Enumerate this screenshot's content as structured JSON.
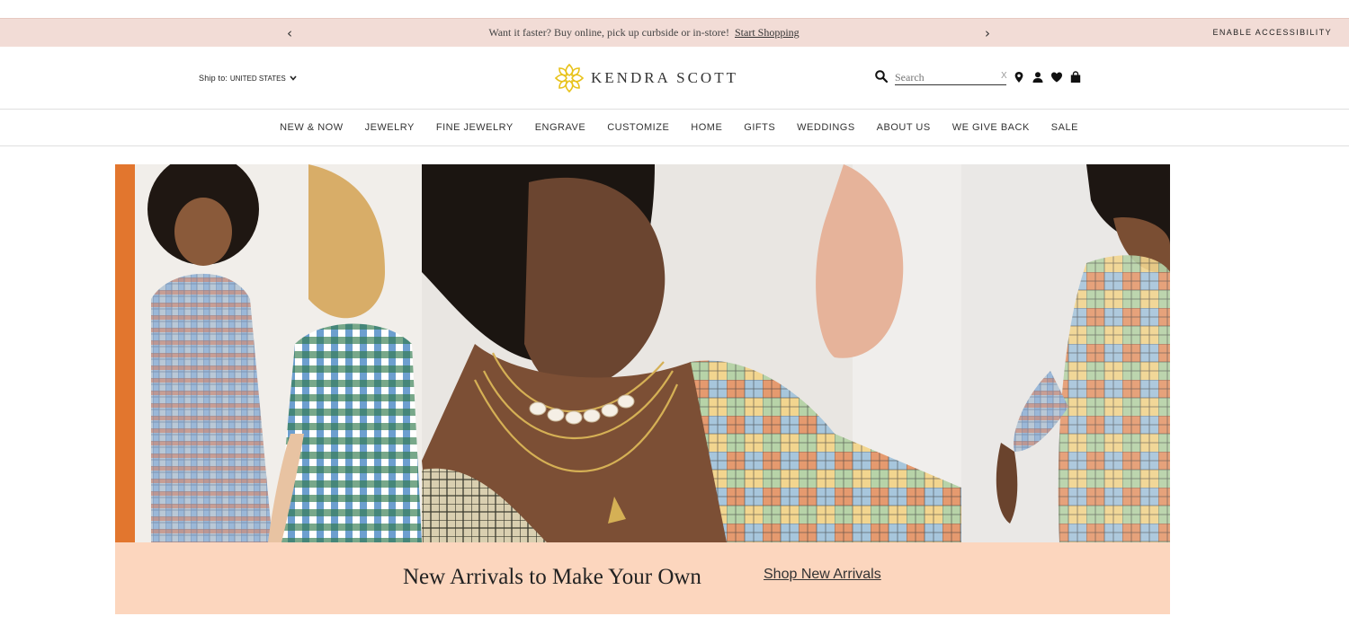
{
  "promo": {
    "prev_label": "‹",
    "next_label": "›",
    "message": "Want it faster? Buy online, pick up curbside or in-store!",
    "link": "Start Shopping",
    "accessibility": "ENABLE ACCESSIBILITY"
  },
  "header": {
    "ship_label": "Ship to:",
    "country": "UNITED STATES",
    "brand": "KENDRA SCOTT",
    "search_placeholder": "Search",
    "search_clear": "X",
    "icons": [
      "location-pin-icon",
      "account-icon",
      "heart-icon",
      "shopping-bag-icon"
    ]
  },
  "nav": {
    "items": [
      "NEW & NOW",
      "JEWELRY",
      "FINE JEWELRY",
      "ENGRAVE",
      "CUSTOMIZE",
      "HOME",
      "GIFTS",
      "WEDDINGS",
      "ABOUT US",
      "WE GIVE BACK",
      "SALE"
    ]
  },
  "hero": {
    "headline": "New Arrivals to Make Your Own",
    "cta": "Shop New Arrivals"
  },
  "colors": {
    "promo_bg": "#f2dcd6",
    "banner_bg": "#fcd6be",
    "logo_gold": "#e8c21a"
  }
}
